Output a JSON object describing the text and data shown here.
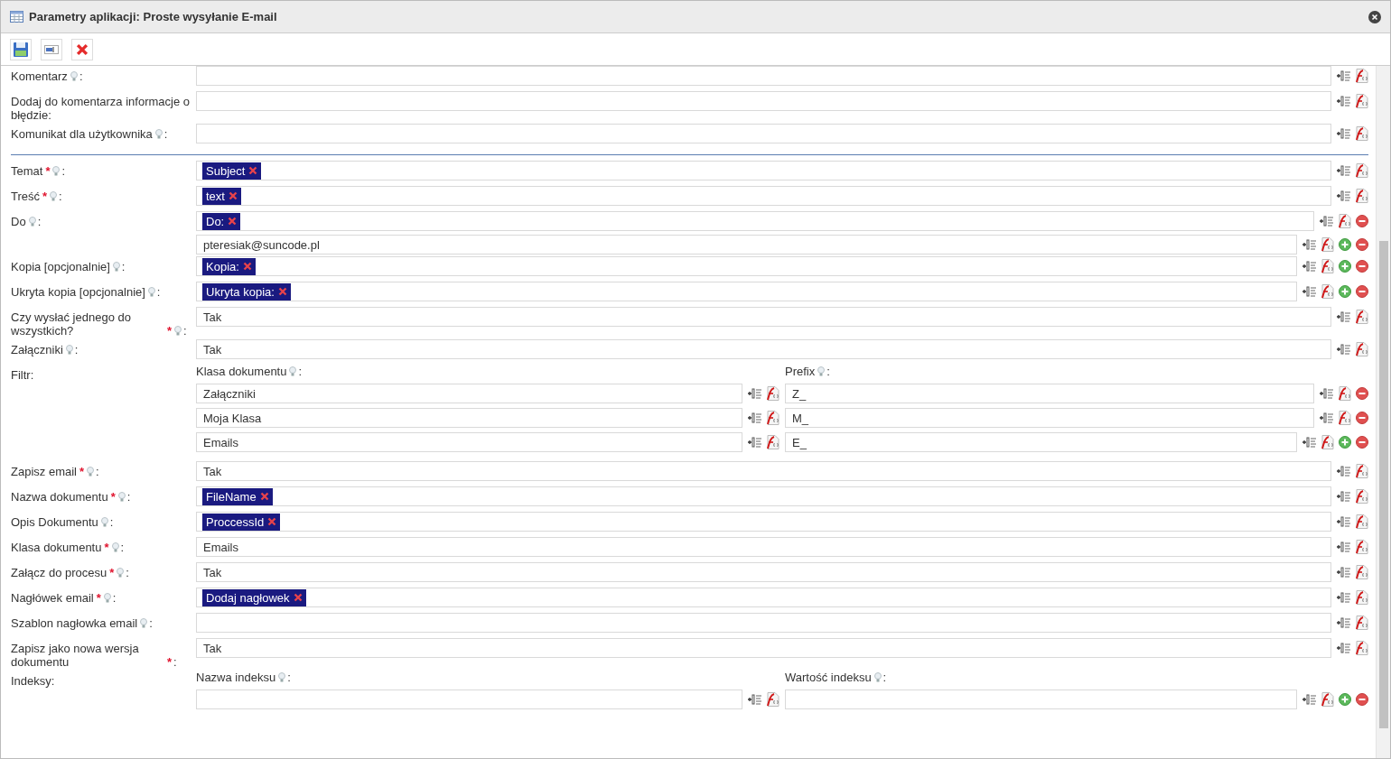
{
  "window": {
    "title": "Parametry aplikacji: Proste wysyłanie E-mail"
  },
  "toolbar": {
    "buttons": [
      {
        "kind": "save"
      },
      {
        "kind": "field"
      },
      {
        "kind": "delete"
      }
    ]
  },
  "sections": [
    {
      "rows": [
        {
          "kind": "single",
          "label": "Komentarz",
          "hint": true,
          "suffix": ":",
          "lines": [
            {
              "add": false,
              "remove": false
            }
          ]
        },
        {
          "kind": "single",
          "label": "Dodaj do komentarza informacje o błędzie:",
          "hint": false,
          "lines": [
            {
              "add": false,
              "remove": false
            }
          ]
        },
        {
          "kind": "single",
          "label": "Komunikat dla użytkownika",
          "hint": true,
          "suffix": ":",
          "lines": [
            {
              "add": false,
              "remove": false
            }
          ]
        }
      ]
    },
    {
      "rows": [
        {
          "kind": "single",
          "label": "Temat",
          "required_mark": "*",
          "hint": true,
          "suffix": ":",
          "lines": [
            {
              "tags": [
                "Subject"
              ]
            }
          ]
        },
        {
          "kind": "single",
          "label": "Treść",
          "required_mark": "*",
          "hint": true,
          "suffix": ":",
          "lines": [
            {
              "tags": [
                "text"
              ]
            }
          ]
        },
        {
          "kind": "single",
          "label": "Do",
          "hint": true,
          "suffix": ":",
          "lines": [
            {
              "tags": [
                "Do:"
              ],
              "add": false,
              "remove": true
            },
            {
              "value": "pteresiak@suncode.pl",
              "add": true,
              "remove": true
            }
          ]
        },
        {
          "kind": "single",
          "label": "Kopia [opcjonalnie]",
          "hint": true,
          "suffix": ":",
          "lines": [
            {
              "tags": [
                "Kopia:"
              ],
              "add": true,
              "remove": true
            }
          ]
        },
        {
          "kind": "single",
          "label": "Ukryta kopia [opcjonalnie]",
          "hint": true,
          "suffix": ":",
          "lines": [
            {
              "tags": [
                "Ukryta kopia:"
              ],
              "add": true,
              "remove": true
            }
          ]
        },
        {
          "kind": "single",
          "label": "Czy wysłać jednego do wszystkich?",
          "required_mark": "*",
          "hint": true,
          "suffix": ":",
          "lines": [
            {
              "value": "Tak"
            }
          ]
        },
        {
          "kind": "single",
          "label": "Załączniki",
          "hint": true,
          "suffix": ":",
          "lines": [
            {
              "value": "Tak"
            }
          ]
        },
        {
          "kind": "table",
          "label": "Filtr:",
          "hint": false,
          "columns": [
            {
              "label": "Klasa dokumentu",
              "hint": true,
              "suffix": ":"
            },
            {
              "label": "Prefix",
              "hint": true,
              "suffix": ":"
            }
          ],
          "lines": [
            {
              "cells": [
                "Załączniki",
                "Z_"
              ],
              "add": false,
              "remove": true
            },
            {
              "cells": [
                "Moja Klasa",
                "M_"
              ],
              "add": false,
              "remove": true
            },
            {
              "cells": [
                "Emails",
                "E_"
              ],
              "add": true,
              "remove": true
            }
          ]
        },
        {
          "kind": "single",
          "label": "Zapisz email",
          "required_mark": "*",
          "hint": true,
          "suffix": ":",
          "lines": [
            {
              "value": "Tak"
            }
          ]
        },
        {
          "kind": "single",
          "label": "Nazwa dokumentu",
          "required_mark": "*",
          "hint": true,
          "suffix": ":",
          "lines": [
            {
              "tags": [
                "FileName"
              ]
            }
          ]
        },
        {
          "kind": "single",
          "label": "Opis Dokumentu",
          "hint": true,
          "suffix": ":",
          "lines": [
            {
              "tags": [
                "ProccessId"
              ]
            }
          ]
        },
        {
          "kind": "single",
          "label": "Klasa dokumentu",
          "required_mark": "*",
          "hint": true,
          "suffix": ":",
          "lines": [
            {
              "value": "Emails"
            }
          ]
        },
        {
          "kind": "single",
          "label": "Załącz do procesu",
          "required_mark": "*",
          "hint": true,
          "suffix": ":",
          "lines": [
            {
              "value": "Tak"
            }
          ]
        },
        {
          "kind": "single",
          "label": "Nagłówek email",
          "required_mark": "*",
          "hint": true,
          "suffix": ":",
          "lines": [
            {
              "tags": [
                "Dodaj nagłowek"
              ]
            }
          ]
        },
        {
          "kind": "single",
          "label": "Szablon nagłowka email",
          "hint": true,
          "suffix": ":",
          "lines": [
            {
              "add": false,
              "remove": false
            }
          ]
        },
        {
          "kind": "single",
          "label": "Zapisz jako nowa wersja dokumentu",
          "required_mark": "*",
          "hint": false,
          "suffix": ":",
          "lines": [
            {
              "value": "Tak"
            }
          ]
        },
        {
          "kind": "table",
          "label": "Indeksy:",
          "hint": false,
          "columns": [
            {
              "label": "Nazwa indeksu",
              "hint": true,
              "suffix": ":"
            },
            {
              "label": "Wartość indeksu",
              "hint": true,
              "suffix": ":"
            }
          ],
          "lines": [
            {
              "cells": [
                null,
                null
              ],
              "add": true,
              "remove": true
            }
          ]
        }
      ]
    }
  ]
}
